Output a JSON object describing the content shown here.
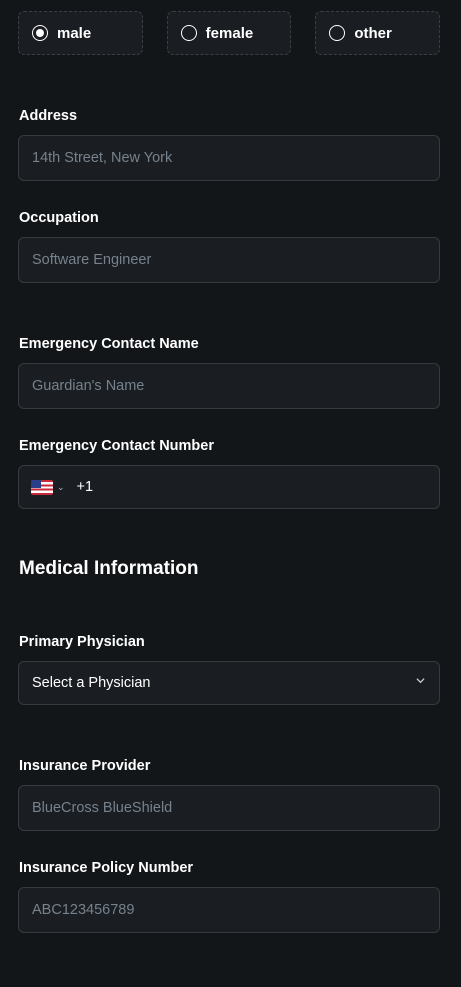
{
  "gender": {
    "options": [
      {
        "label": "male",
        "selected": true
      },
      {
        "label": "female",
        "selected": false
      },
      {
        "label": "other",
        "selected": false
      }
    ]
  },
  "address": {
    "label": "Address",
    "placeholder": "14th Street, New York"
  },
  "occupation": {
    "label": "Occupation",
    "placeholder": "Software Engineer"
  },
  "emergency_name": {
    "label": "Emergency Contact Name",
    "placeholder": "Guardian's Name"
  },
  "emergency_number": {
    "label": "Emergency Contact Number",
    "dial_code": "+1",
    "flag": "us-flag-icon"
  },
  "medical": {
    "title": "Medical Information"
  },
  "physician": {
    "label": "Primary Physician",
    "value": "Select a Physician"
  },
  "insurance_provider": {
    "label": "Insurance Provider",
    "placeholder": "BlueCross BlueShield"
  },
  "insurance_policy": {
    "label": "Insurance Policy Number",
    "placeholder": "ABC123456789"
  }
}
